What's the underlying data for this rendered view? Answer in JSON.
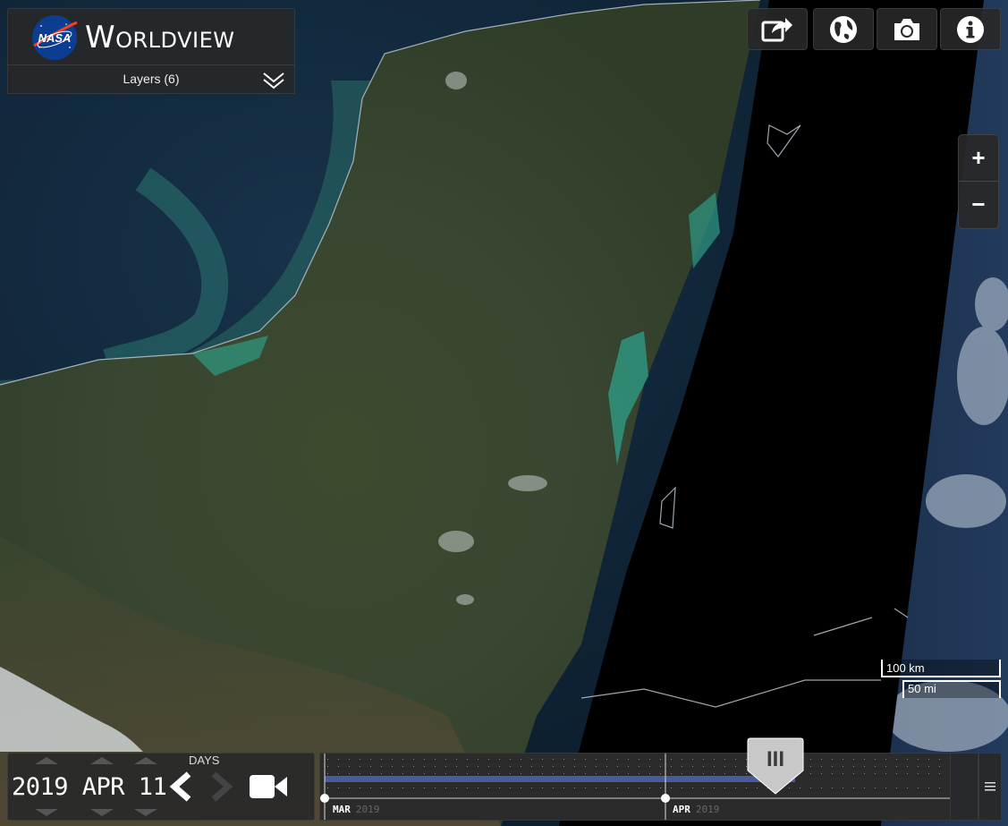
{
  "app": {
    "logo_text": "NASA",
    "title": "Worldview"
  },
  "layers": {
    "label": "Layers (6)"
  },
  "toolbar": {
    "buttons": [
      {
        "icon": "share-icon"
      },
      {
        "icon": "projection-globe-icon"
      },
      {
        "icon": "camera-icon"
      },
      {
        "icon": "info-icon"
      }
    ]
  },
  "zoom": {
    "in_label": "+",
    "out_label": "−"
  },
  "scale": {
    "km_label": "100 km",
    "mi_label": "50 mi"
  },
  "timeline": {
    "date": "2019 APR 11",
    "interval_label": "DAYS",
    "months": [
      {
        "month": "MAR",
        "year": "2019"
      },
      {
        "month": "APR",
        "year": "2019"
      }
    ],
    "handle_label": "III"
  },
  "colors": {
    "panel_bg": "#282828",
    "available_bar": "#4a5a9a",
    "land": "#3b4a2e",
    "ocean": "#0f2233",
    "shallow_water": "#2f8a78"
  }
}
